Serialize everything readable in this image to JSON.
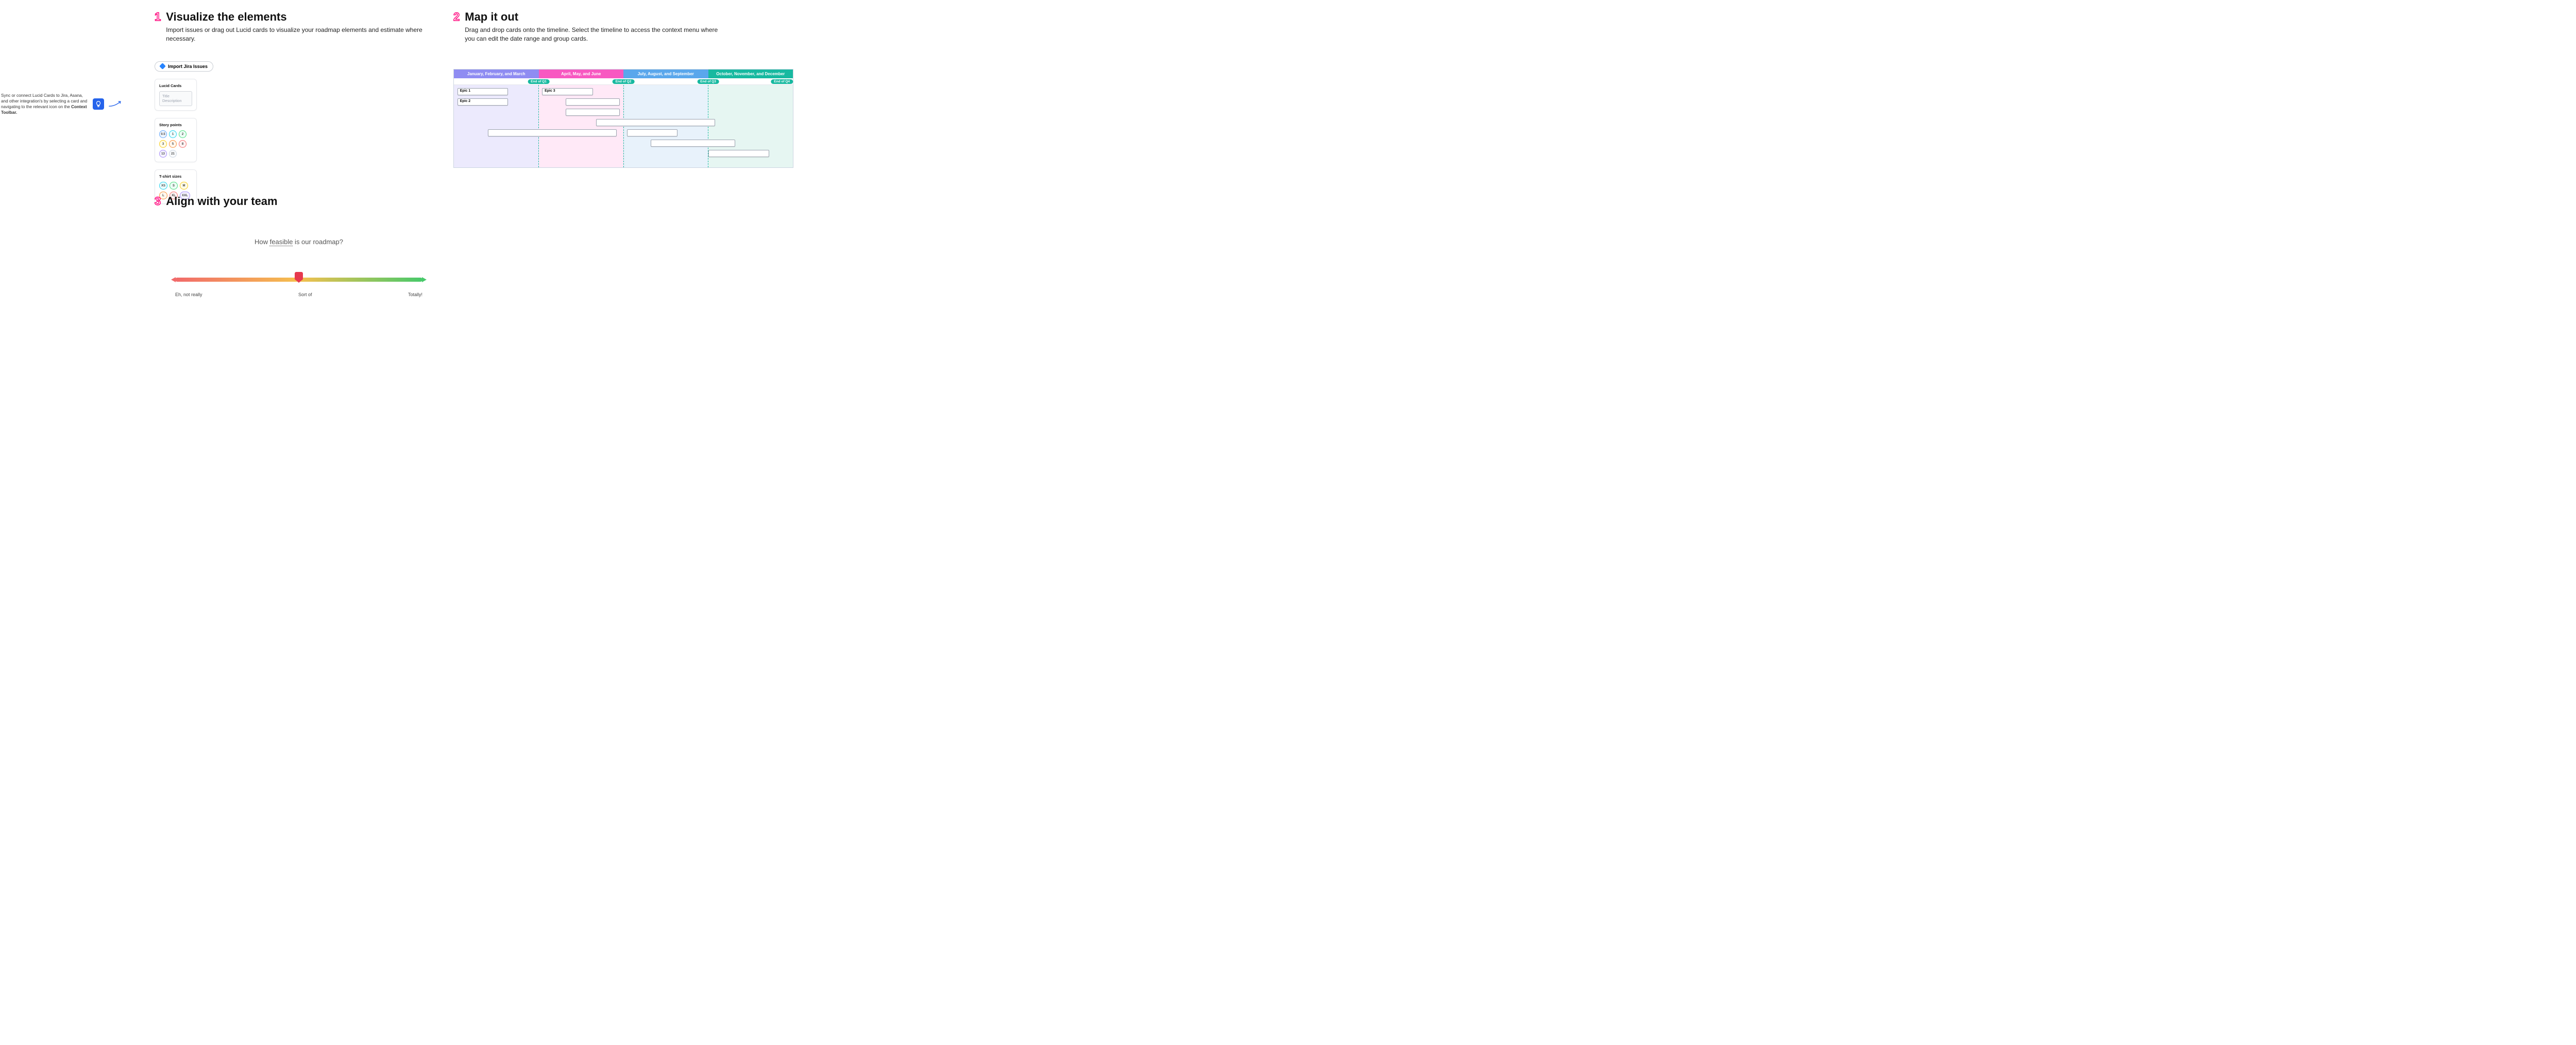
{
  "step1": {
    "num": "1",
    "title": "Visualize the elements",
    "desc": "Import issues or drag out Lucid cards to visualize your roadmap elements and estimate where necessary."
  },
  "tip": {
    "text_pre": "Sync or connect Lucid Cards to Jira, Asana, and other integration's by selecting a card and navigating to the relevant icon on the ",
    "text_bold": "Context Toolbar.",
    "icon_glyph": "💡"
  },
  "imports": {
    "jira_label": "Import Jira Issues"
  },
  "lucid": {
    "panel_title": "Lucid Cards",
    "placeholder_title": "Title",
    "placeholder_desc": "Description"
  },
  "story": {
    "panel_title": "Story points",
    "values": [
      "0.5",
      "1",
      "2",
      "3",
      "5",
      "8",
      "13",
      "21"
    ]
  },
  "tshirt": {
    "panel_title": "T-shirt sizes",
    "values": [
      "XS",
      "S",
      "M",
      "L",
      "XL",
      "XXL"
    ]
  },
  "step2": {
    "num": "2",
    "title": "Map it out",
    "desc": "Drag and drop cards onto the timeline. Select the timeline to access the context menu where you can edit the date range and group cards."
  },
  "timeline": {
    "headers": [
      "January, February, and March",
      "April, May, and June",
      "July, August, and September",
      "October, November, and December"
    ],
    "markers": [
      "End of Q1",
      "End of Q2",
      "End of Q3",
      "End of Q4"
    ],
    "cards": {
      "epic1": "Epic 1",
      "epic2": "Epic 2",
      "epic3": "Epic 3",
      "blank": ""
    }
  },
  "step3": {
    "num": "3",
    "title": "Align with your team",
    "prompt_pre": "How ",
    "prompt_u": "feasible",
    "prompt_post": " is our roadmap?",
    "labels": {
      "left": "Eh, not really",
      "mid": "Sort of",
      "right": "Totally!"
    }
  }
}
